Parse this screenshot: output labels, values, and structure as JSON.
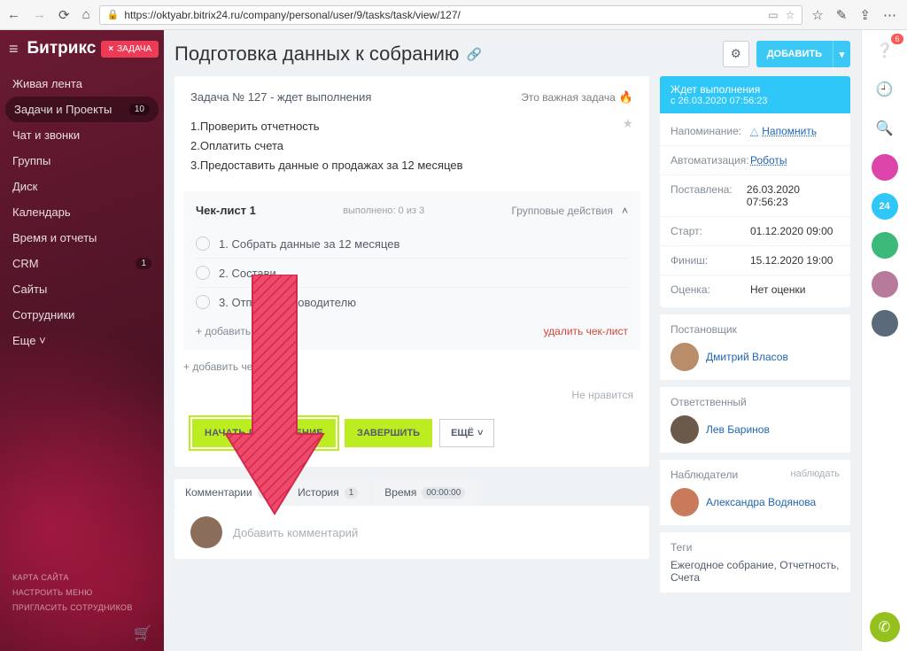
{
  "browser": {
    "url": "https://oktyabr.bitrix24.ru/company/personal/user/9/tasks/task/view/127/"
  },
  "sidebar": {
    "brand": "Битрикс",
    "task_chip": "ЗАДАЧА",
    "items": [
      {
        "label": "Живая лента"
      },
      {
        "label": "Задачи и Проекты",
        "badge": "10",
        "active": true
      },
      {
        "label": "Чат и звонки"
      },
      {
        "label": "Группы"
      },
      {
        "label": "Диск"
      },
      {
        "label": "Календарь"
      },
      {
        "label": "Время и отчеты"
      },
      {
        "label": "CRM",
        "badge": "1"
      },
      {
        "label": "Сайты"
      },
      {
        "label": "Сотрудники"
      },
      {
        "label": "Еще ˅"
      }
    ],
    "footer": [
      "КАРТА САЙТА",
      "НАСТРОИТЬ МЕНЮ",
      "ПРИГЛАСИТЬ СОТРУДНИКОВ"
    ]
  },
  "page": {
    "title": "Подготовка данных к собранию",
    "add_button": "ДОБАВИТЬ"
  },
  "task": {
    "status_line": "Задача № 127 - ждет выполнения",
    "important_label": "Это важная задача",
    "description": [
      "1.Проверить отчетность",
      "2.Оплатить счета",
      "3.Предоставить данные о продажах за 12 месяцев"
    ],
    "checklist": {
      "title": "Чек-лист 1",
      "progress": "выполнено: 0 из 3",
      "group_actions": "Групповые действия",
      "items": [
        "1. Собрать данные за 12 месяцев",
        "2. Состави",
        "3. Отправи         руководителю"
      ],
      "add_item": "+ добавить пу",
      "delete": "удалить чек-лист",
      "add_checklist": "+ добавить чек-л"
    },
    "dislike": "Не нравится",
    "actions": {
      "start": "НАЧАТЬ ВЫПОЛНЕНИЕ",
      "finish": "ЗАВЕРШИТЬ",
      "more": "ЕЩЁ"
    },
    "tabs": {
      "comments": "Комментарии",
      "comments_count": "0",
      "history": "История",
      "history_count": "1",
      "time": "Время",
      "time_value": "00:00:00"
    },
    "comment_placeholder": "Добавить комментарий"
  },
  "side": {
    "header_title": "Ждет выполнения",
    "header_sub": "с 26.03.2020 07:56:23",
    "rows": {
      "reminder_k": "Напоминание:",
      "reminder_v": "Напомнить",
      "automation_k": "Автоматизация:",
      "automation_v": "Роботы",
      "created_k": "Поставлена:",
      "created_v": "26.03.2020 07:56:23",
      "start_k": "Старт:",
      "start_v": "01.12.2020 09:00",
      "finish_k": "Финиш:",
      "finish_v": "15.12.2020 19:00",
      "rating_k": "Оценка:",
      "rating_v": "Нет оценки"
    },
    "creator_title": "Постановщик",
    "creator_name": "Дмитрий Власов",
    "responsible_title": "Ответственный",
    "responsible_name": "Лев Баринов",
    "watchers_title": "Наблюдатели",
    "watch_action": "наблюдать",
    "watcher_name": "Александра Водянова",
    "tags_title": "Теги",
    "tags_value": "Ежегодное собрание, Отчетность, Счета"
  },
  "right_rail": {
    "notif_count": "6",
    "b24": "24"
  }
}
